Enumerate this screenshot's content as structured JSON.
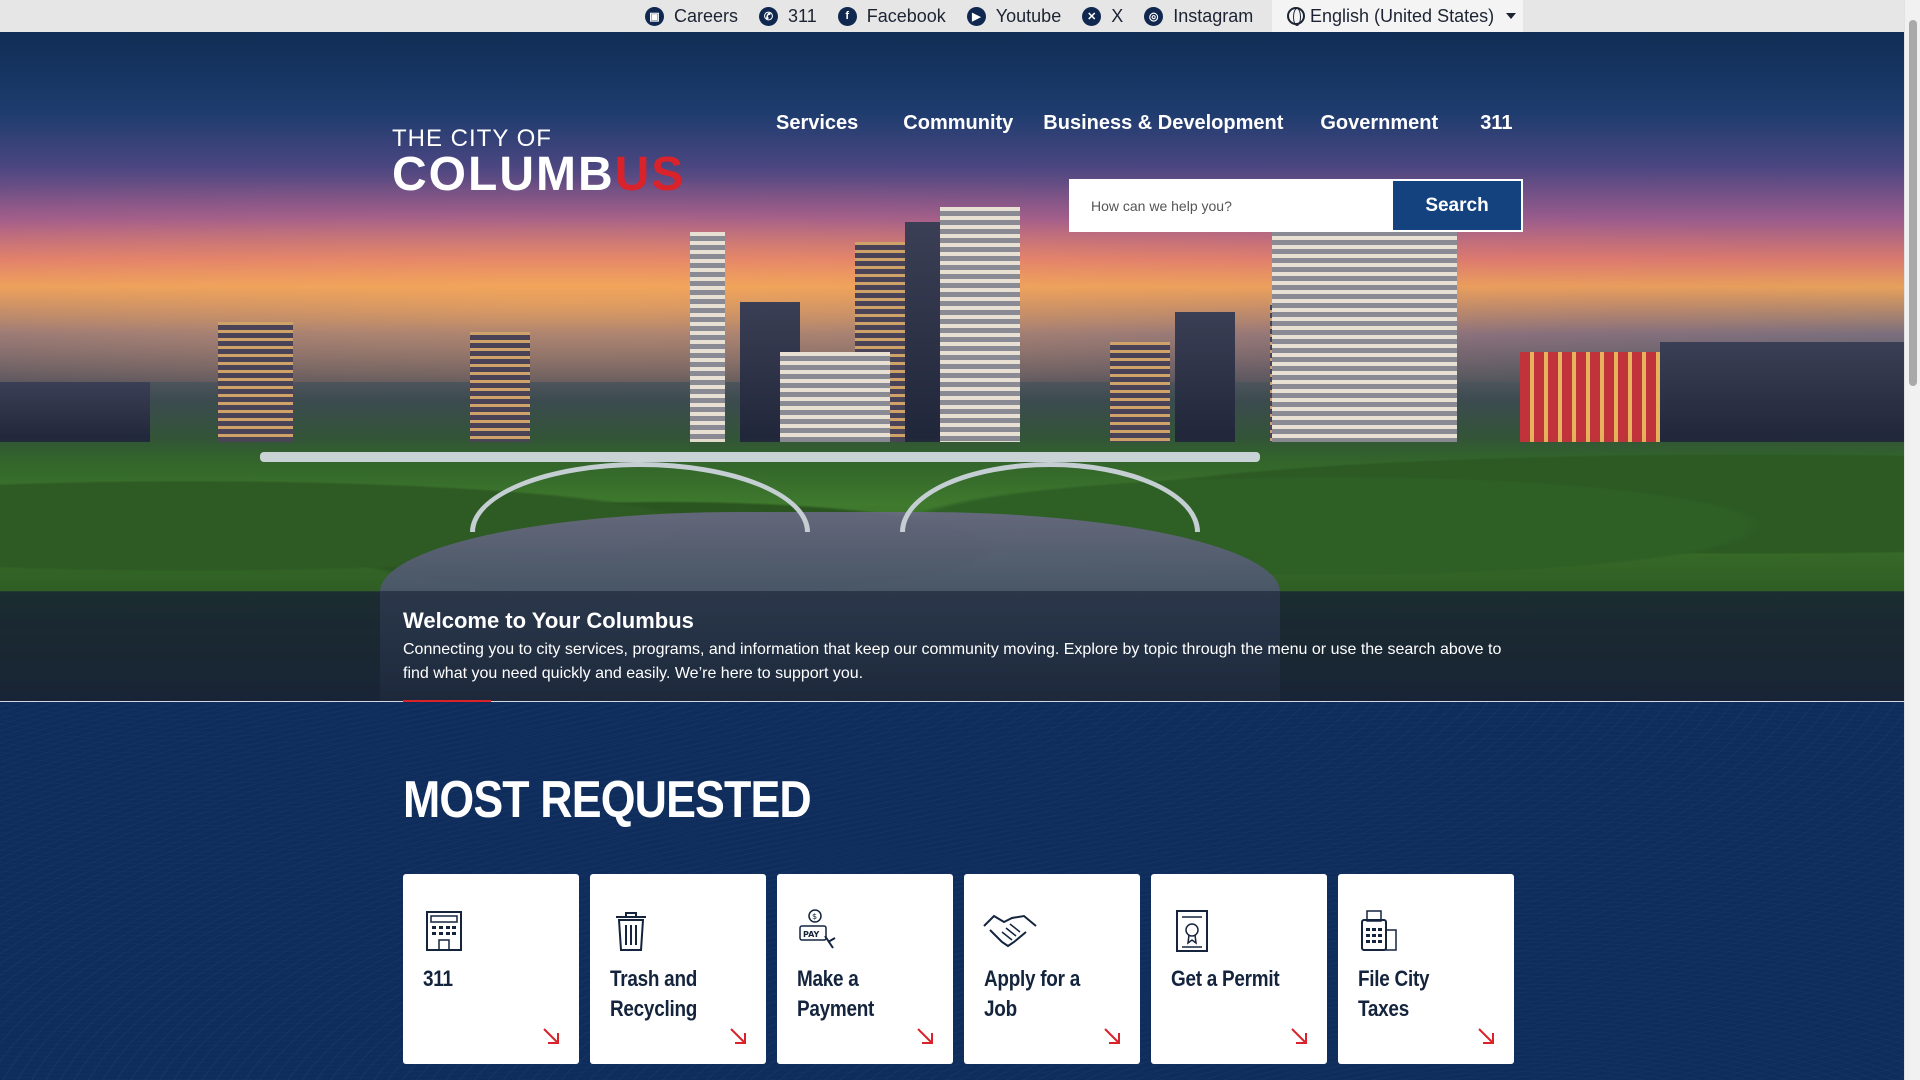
{
  "topbar": {
    "links": [
      {
        "label": "Careers",
        "icon": "briefcase-icon",
        "glyph": "▣"
      },
      {
        "label": "311",
        "icon": "phone-icon",
        "glyph": "✆"
      },
      {
        "label": "Facebook",
        "icon": "facebook-icon",
        "glyph": "f"
      },
      {
        "label": "Youtube",
        "icon": "youtube-icon",
        "glyph": "▶"
      },
      {
        "label": "X",
        "icon": "x-icon",
        "glyph": "✕"
      },
      {
        "label": "Instagram",
        "icon": "instagram-icon",
        "glyph": "◎"
      }
    ],
    "language": "English (United States)"
  },
  "logo": {
    "top": "THE CITY OF",
    "main_a": "COLUMB",
    "main_b": "US"
  },
  "nav": {
    "items": [
      "Services",
      "Community",
      "Business & Development",
      "Government",
      "311"
    ]
  },
  "search": {
    "placeholder": "How can we help you?",
    "button": "Search"
  },
  "welcome": {
    "title": "Welcome to Your Columbus",
    "text": "Connecting you to city services, programs, and information that keep our community moving. Explore by topic through the menu or use the search above to find what you need quickly and easily. We’re here to support you."
  },
  "most_requested": {
    "title": "MOST REQUESTED",
    "cards": [
      {
        "label": "311",
        "icon": "building-icon"
      },
      {
        "label": "Trash and Recycling",
        "icon": "trash-icon"
      },
      {
        "label": "Make a Payment",
        "icon": "pay-icon"
      },
      {
        "label": "Apply for a Job",
        "icon": "handshake-icon"
      },
      {
        "label": "Get a Permit",
        "icon": "permit-icon"
      },
      {
        "label": "File City Taxes",
        "icon": "calculator-icon"
      }
    ]
  },
  "colors": {
    "brand_red": "#d9222a",
    "navy": "#0f2d5c",
    "button_blue": "#13427f"
  }
}
